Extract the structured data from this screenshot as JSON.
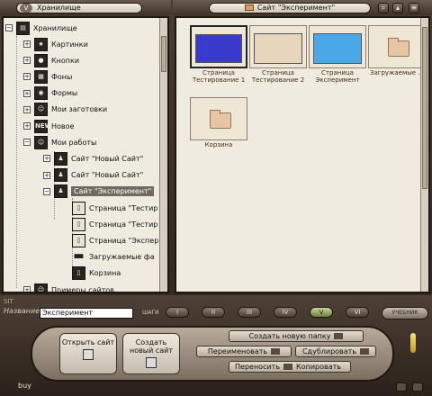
{
  "top": {
    "storage_btn": "V",
    "storage_title": "Хранилище",
    "site_title": "Сайт \"Эксперимент\""
  },
  "tree": {
    "root": "Хранилище",
    "items": [
      {
        "label": "Картинки",
        "icon": "star-icon",
        "glyph": "★"
      },
      {
        "label": "Кнопки",
        "icon": "button-icon",
        "glyph": "●"
      },
      {
        "label": "Фоны",
        "icon": "background-icon",
        "glyph": "▦"
      },
      {
        "label": "Формы",
        "icon": "form-icon",
        "glyph": "◉"
      },
      {
        "label": "Мои заготовки",
        "icon": "smiley-icon",
        "glyph": "☺"
      },
      {
        "label": "Новое",
        "icon": "new-icon",
        "glyph": "NEW"
      },
      {
        "label": "Мои работы",
        "icon": "works-icon",
        "glyph": "☺"
      },
      {
        "label": "Сайт \"Новый Сайт\"",
        "icon": "site-icon",
        "glyph": "♟"
      },
      {
        "label": "Сайт \"Новый Сайт\"",
        "icon": "site-icon",
        "glyph": "♟"
      },
      {
        "label": "Сайт \"Эксперимент\"",
        "icon": "site-icon",
        "glyph": "♟"
      },
      {
        "label": "Страница \"Тестир",
        "icon": "page-icon",
        "glyph": "▯"
      },
      {
        "label": "Страница \"Тестир",
        "icon": "page-icon",
        "glyph": "▯"
      },
      {
        "label": "Страница \"Экспер",
        "icon": "page-icon",
        "glyph": "▯"
      },
      {
        "label": "Загружаемые фа",
        "icon": "folder-icon",
        "glyph": "▬"
      },
      {
        "label": "Корзина",
        "icon": "trash-icon",
        "glyph": "▯"
      },
      {
        "label": "Примеры сайтов",
        "icon": "examples-icon",
        "glyph": "☺"
      }
    ]
  },
  "files": [
    {
      "label": "Страница Тестирование 1"
    },
    {
      "label": "Страница Тестирование 2"
    },
    {
      "label": "Страница Эксперимент"
    },
    {
      "label": "Загружаемые ..."
    },
    {
      "label": "Корзина"
    }
  ],
  "console": {
    "sit": "SIT",
    "name_label": "Название:",
    "name_value": "Эксперимент",
    "steps_label": "ШАГИ",
    "steps": [
      "I",
      "II",
      "III",
      "IV",
      "V",
      "VI"
    ],
    "active_step": "V",
    "tutorial": "УЧЕБНИК",
    "open_site": "Открыть сайт",
    "create_site": "Создать новый сайт",
    "create_folder": "Создать новую папку",
    "rename": "Переименовать",
    "duplicate": "Сдублировать",
    "move": "Переносить",
    "copy": "Копировать",
    "buy": "buy"
  },
  "colors": {
    "frame": "#3a2e26",
    "pane_bg": "#f0ebe0",
    "selection": "#706a60",
    "active_step": "#a8c060"
  }
}
